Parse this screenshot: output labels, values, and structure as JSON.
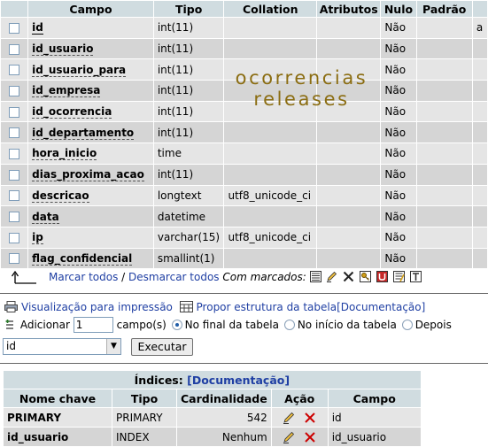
{
  "structure": {
    "headers": [
      "",
      "Campo",
      "Tipo",
      "Collation",
      "Atributos",
      "Nulo",
      "Padrão",
      ""
    ],
    "rows": [
      {
        "field": "id",
        "type": "int(11)",
        "collation": "",
        "null": "Não",
        "extra": "a"
      },
      {
        "field": "id_usuario",
        "type": "int(11)",
        "collation": "",
        "null": "Não",
        "extra": ""
      },
      {
        "field": "id_usuario_para",
        "type": "int(11)",
        "collation": "",
        "null": "Não",
        "extra": ""
      },
      {
        "field": "id_empresa",
        "type": "int(11)",
        "collation": "",
        "null": "Não",
        "extra": ""
      },
      {
        "field": "id_ocorrencia",
        "type": "int(11)",
        "collation": "",
        "null": "Não",
        "extra": ""
      },
      {
        "field": "id_departamento",
        "type": "int(11)",
        "collation": "",
        "null": "Não",
        "extra": ""
      },
      {
        "field": "hora_inicio",
        "type": "time",
        "collation": "",
        "null": "Não",
        "extra": ""
      },
      {
        "field": "dias_proxima_acao",
        "type": "int(11)",
        "collation": "",
        "null": "Não",
        "extra": ""
      },
      {
        "field": "descricao",
        "type": "longtext",
        "collation": "utf8_unicode_ci",
        "null": "Não",
        "extra": ""
      },
      {
        "field": "data",
        "type": "datetime",
        "collation": "",
        "null": "Não",
        "extra": ""
      },
      {
        "field": "ip",
        "type": "varchar(15)",
        "collation": "utf8_unicode_ci",
        "null": "Não",
        "extra": ""
      },
      {
        "field": "flag_confidencial",
        "type": "smallint(1)",
        "collation": "",
        "null": "Não",
        "extra": ""
      }
    ]
  },
  "overlay": {
    "line1": "ocorrencias",
    "line2": "releases"
  },
  "checkbar": {
    "check_all": "Marcar todos",
    "separator": " / ",
    "uncheck_all": "Desmarcar todos",
    "with_selected": "Com marcados:",
    "tool_icons": [
      "browse-icon",
      "edit-icon",
      "delete-icon",
      "primary-key-icon",
      "unique-icon",
      "index-icon",
      "fulltext-icon"
    ]
  },
  "print": {
    "print_view": "Visualização para impressão",
    "propose": "Propor estrutura da tabela",
    "doc_link": "[Documentação]"
  },
  "add": {
    "label": "Adicionar",
    "count": "1",
    "fields_label": "campo(s)",
    "opt_end": "No final da tabela",
    "opt_start": "No início da tabela",
    "opt_after": "Depois",
    "after_select": "id",
    "execute": "Executar"
  },
  "indexes": {
    "title": "Índices:",
    "doc_link": "[Documentação]",
    "headers": [
      "Nome chave",
      "Tipo",
      "Cardinalidade",
      "Ação",
      "Campo"
    ],
    "rows": [
      {
        "name": "PRIMARY",
        "type": "PRIMARY",
        "cardinality": "542",
        "field": "id"
      },
      {
        "name": "id_usuario",
        "type": "INDEX",
        "cardinality": "Nenhum",
        "field": "id_usuario"
      }
    ]
  },
  "colors": {
    "header_bg": "#d0dce0",
    "row_odd": "#e5e5e5",
    "row_even": "#d5d5d5",
    "link": "#1f3fa3",
    "overlay_text": "#8b6d12",
    "delete_red": "#cc0000"
  }
}
